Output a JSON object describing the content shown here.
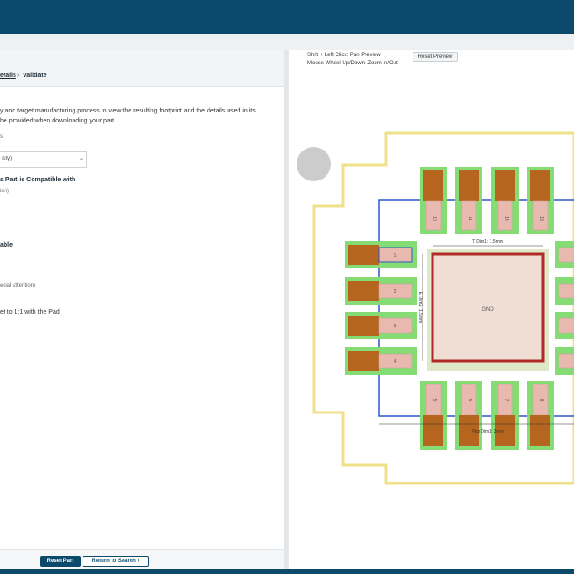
{
  "left_panel": {
    "tabs": {
      "details": "etails",
      "separator": "›",
      "validate": "Validate"
    },
    "description": [
      "y and target manufacturing process to view the resulting footprint and the details used in its",
      "be provided when downloading your part."
    ],
    "select_label": "s",
    "select_value": "sity)",
    "compat_heading": "s Part is Compatible with",
    "compat_note": "ion)",
    "able_heading": "able",
    "special_note": "ecial attention)",
    "pad_text": "et to 1:1 with the Pad"
  },
  "footer": {
    "reset_label": "Reset Part",
    "return_label": "Return to Search",
    "return_icon": "chevron-right-icon"
  },
  "preview": {
    "hint_pan": "Shift + Left Click: Pan Preview",
    "hint_zoom": "Mouse Wheel Up/Down: Zoom In/Out",
    "reset_preview_label": "Reset Preview",
    "pad_numbers": {
      "top": [
        "10",
        "11",
        "14",
        "13"
      ],
      "left": [
        "1",
        "2",
        "3",
        "4"
      ],
      "bottom": [
        "5",
        "6",
        "7",
        "8"
      ]
    },
    "gnd_label": "GND",
    "dim_t": "T Dim1: 1.5mm",
    "dim_e": "E Dim2: 1.5mm",
    "dim_pkg": "Pkg Dim1: 3mm",
    "colors": {
      "courtyard": "#efe08a",
      "body_outline": "#2f56c9",
      "copper": "#b5651d",
      "mask": "#86dc74",
      "pad": "#e9b9b0",
      "thermal": "#b02a2a",
      "thermal_fill": "#f0ddd4"
    }
  }
}
